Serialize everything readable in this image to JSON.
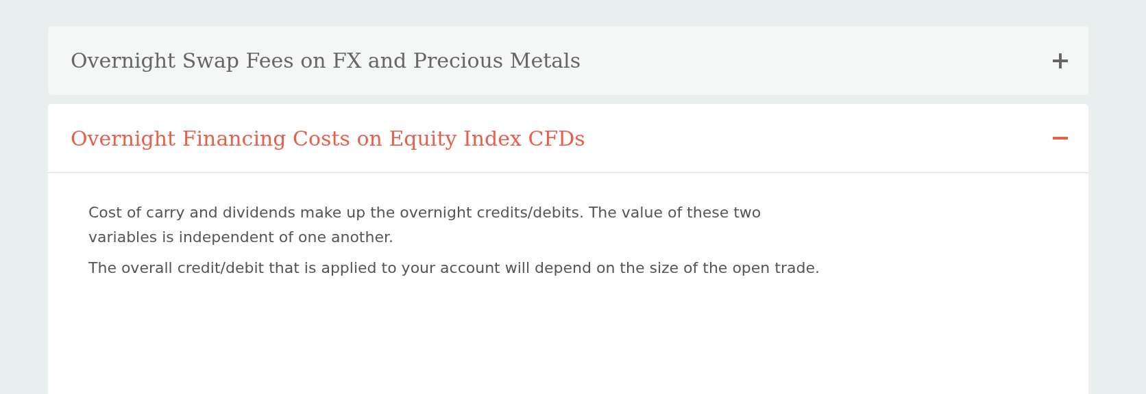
{
  "accordion": [
    {
      "title": "Overnight Swap Fees on FX and Precious Metals",
      "expanded": false
    },
    {
      "title": "Overnight Financing Costs on Equity Index CFDs",
      "expanded": true,
      "paragraphs": [
        "Cost of carry and dividends make up the overnight credits/debits. The value of these two variables is independent of one another.",
        "The overall credit/debit that is applied to your account will depend on the size of the open trade."
      ]
    }
  ]
}
